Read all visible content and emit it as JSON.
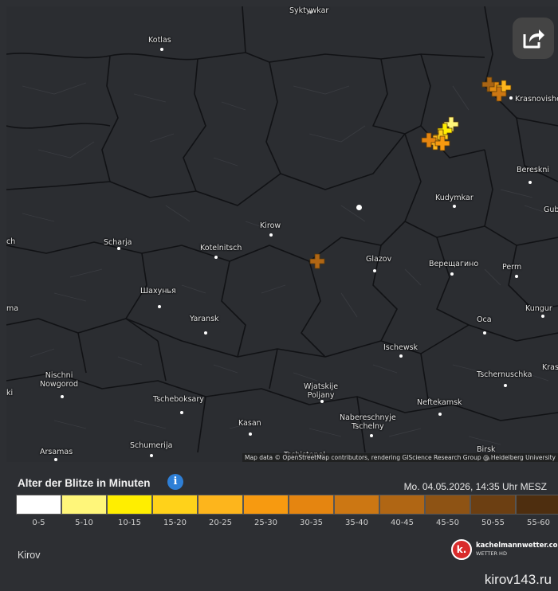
{
  "map": {
    "cities": [
      {
        "name": "Syktywkar",
        "id": "syktywkar"
      },
      {
        "name": "Kotlas",
        "id": "kotlas"
      },
      {
        "name": "Krasnovishe",
        "id": "krasnovishe"
      },
      {
        "name": "Bereskni",
        "id": "bereskni"
      },
      {
        "name": "Kudymkar",
        "id": "kudymkar"
      },
      {
        "name": "Gub",
        "id": "gub"
      },
      {
        "name": "Kirow",
        "id": "kirow"
      },
      {
        "name": "Scharja",
        "id": "scharja"
      },
      {
        "name": "Kotelnitsch",
        "id": "kotelnitsch"
      },
      {
        "name": "Glazov",
        "id": "glazov"
      },
      {
        "name": "Верещагино",
        "id": "vereshchagino"
      },
      {
        "name": "Perm",
        "id": "perm"
      },
      {
        "name": "ch",
        "id": "edge-ch"
      },
      {
        "name": "Шахунья",
        "id": "shakhunya"
      },
      {
        "name": "ma",
        "id": "edge-ma"
      },
      {
        "name": "Kungur",
        "id": "kungur"
      },
      {
        "name": "Yaransk",
        "id": "yaransk"
      },
      {
        "name": "Oca",
        "id": "oca"
      },
      {
        "name": "Ischewsk",
        "id": "ischewsk"
      },
      {
        "name": "Nischni\nNowgorod",
        "id": "nizhny"
      },
      {
        "name": "Tschernuschka",
        "id": "chernushka"
      },
      {
        "name": "Krasn",
        "id": "krasn"
      },
      {
        "name": "ki",
        "id": "edge-ki"
      },
      {
        "name": "Wjatskije\nPoljany",
        "id": "vyatskie"
      },
      {
        "name": "Tscheboksary",
        "id": "cheboksary"
      },
      {
        "name": "Neftekamsk",
        "id": "neftekamsk"
      },
      {
        "name": "Nabereschnyje\nTschelny",
        "id": "chelny"
      },
      {
        "name": "Kasan",
        "id": "kasan"
      },
      {
        "name": "Schumerija",
        "id": "shumerlya"
      },
      {
        "name": "Arsamas",
        "id": "arsamas"
      },
      {
        "name": "Birsk",
        "id": "birsk"
      },
      {
        "name": "Tschistopol",
        "id": "chistopol"
      }
    ],
    "attribution": "Map data © OpenStreetMap contributors, rendering GIScience Research Group @ Heidelberg University"
  },
  "share_icon": "share-icon",
  "legend": {
    "title": "Alter der Blitze in Minuten",
    "info_icon": "i",
    "timestamp": "Mo. 04.05.2026, 14:35 Uhr MESZ",
    "colors": [
      "#ffffff",
      "#fff67a",
      "#ffee00",
      "#ffd21a",
      "#fdb51c",
      "#f79a10",
      "#e58510",
      "#cc7713",
      "#b06614",
      "#8e5314",
      "#6c3f12",
      "#4e2e0f"
    ],
    "labels": [
      "0-5",
      "5-10",
      "10-15",
      "15-20",
      "20-25",
      "25-30",
      "30-35",
      "35-40",
      "40-45",
      "45-50",
      "50-55",
      "55-60"
    ]
  },
  "place": "Kirov",
  "brand": {
    "name": "kachelmannwetter.com",
    "sub": "WETTER HD",
    "logo": "k."
  },
  "watermark": "kirov143.ru"
}
